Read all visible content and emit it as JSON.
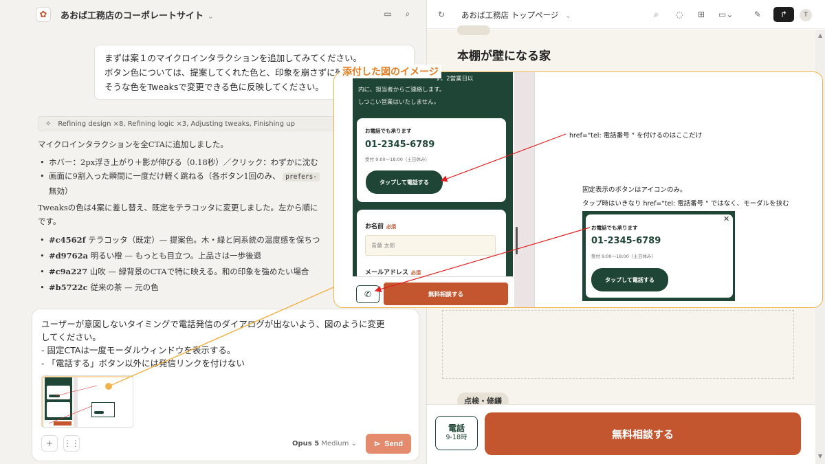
{
  "chat": {
    "project_title": "あおば工務店のコーポレートサイト",
    "user_message_1": [
      "まずは案１のマイクロインタラクションを追加してみてください。",
      "ボタン色については、提案してくれた色と、印象を崩さずに殆",
      "そうな色をTweaksで変更できる色に反映してください。"
    ],
    "progress_chip": "Refining design ×8, Refining logic ×3, Adjusting tweaks, Finishing up",
    "reply": {
      "intro": "マイクロインタラクションを全CTAに追加しました。",
      "bullet1": "ホバー：2px浮き上がり＋影が伸びる（0.18秒）／クリック：わずかに沈む",
      "bullet2_a": "画面に9割入った瞬間に一度だけ軽く跳ねる（各ボタン1回のみ、",
      "bullet2_code": "prefers-",
      "bullet2_b": "無効）",
      "para2_a": "Tweaksの色は4案に差し替え、既定をテラコッタに変更しました。左から順に",
      "para2_b": "です。",
      "colors": [
        {
          "hex": "#c4562f",
          "text": "テラコッタ（既定）— 提案色。木・緑と同系統の温度感を保ちつ"
        },
        {
          "hex": "#d9762a",
          "text": "明るい橙 — もっとも目立つ。上品さは一歩後退"
        },
        {
          "hex": "#c9a227",
          "text": "山吹 — 緑背景のCTAで特に映える。和の印象を強めたい場合"
        },
        {
          "hex": "#b5722c",
          "text": "従来の茶 — 元の色"
        }
      ]
    },
    "composer": {
      "lines": [
        "ユーザーが意図しないタイミングで電話発信のダイアログが出ないよう、図のように変更",
        "してください。",
        "- 固定CTAは一度モーダルウィンドウを表示する。",
        "- 「電話する」ボタン以外には発信リンクを付けない"
      ],
      "model_name": "Opus 5",
      "model_effort": "Medium",
      "send_label": "Send"
    }
  },
  "preview": {
    "page_title": "あおば工務店 トップページ",
    "avatar_initial": "T",
    "section_heading": "本棚が壁になる家",
    "tag_chip": "点検・修繕",
    "sticky_phone_line1": "電話",
    "sticky_phone_line2": "9-18時",
    "sticky_cta": "無料相談する"
  },
  "overlay": {
    "label": "添付した図のイメージ",
    "phone_text_1": "内に、担当者からご連絡します。",
    "phone_text_2": "しつこい営業はいたしません。",
    "phone_text_top": "す。2営業日以",
    "card_title": "お電話でも承ります",
    "phone_number": "01-2345-6789",
    "hours": "受付 9:00〜18:00（土日休み）",
    "call_button": "タップして電話する",
    "form_name_label": "お名前",
    "form_required": "必須",
    "form_name_placeholder": "青葉 太郎",
    "form_email_label": "メールアドレス",
    "bottom_cta": "無料相談する",
    "annotation_1": "href=\"tel: 電話番号 \" を付けるのはここだけ",
    "annotation_2": "固定表示のボタンはアイコンのみ。",
    "annotation_3": "タップ時はいきなり href=\"tel: 電話番号 \" ではなく、モーダルを挟む",
    "modal_title": "お電話でも承ります",
    "modal_number": "01-2345-6789",
    "modal_hours": "受付 9:00〜18:00（土日休み）",
    "modal_button": "タップして電話する"
  },
  "colors": {
    "accent": "#c4562f",
    "green": "#1f4536",
    "overlay_border": "#f0b34a",
    "annotation_line": "#e02020"
  },
  "icons": [
    "palette-icon",
    "sidebar-icon",
    "chat-bubble-icon",
    "refresh-icon",
    "search-icon",
    "comment-icon",
    "components-icon",
    "device-icon",
    "pencil-icon",
    "share-icon",
    "phone-icon",
    "plus-icon",
    "voice-icon",
    "send-icon",
    "close-icon",
    "sparkle-icon"
  ]
}
